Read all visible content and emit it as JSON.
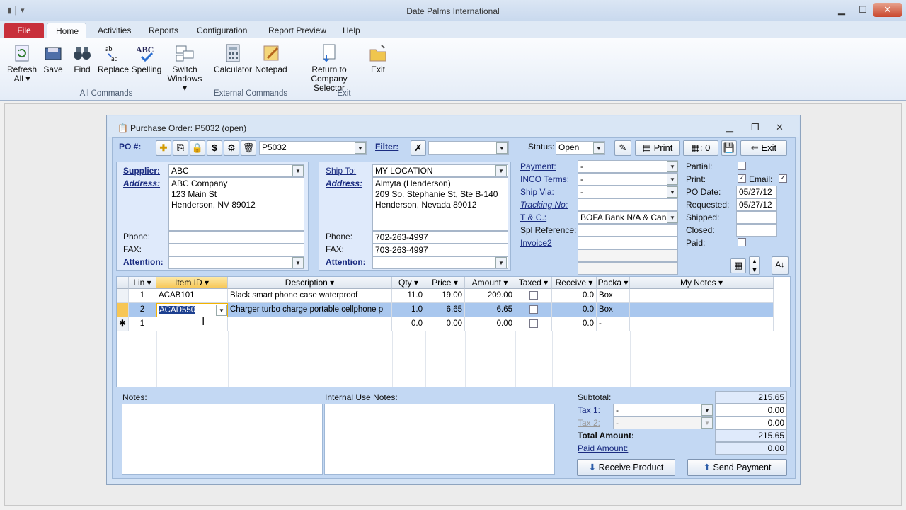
{
  "app": {
    "title": "Date Palms International"
  },
  "ribbon": {
    "tabs": [
      "File",
      "Home",
      "Activities",
      "Reports",
      "Configuration",
      "Report Preview",
      "Help"
    ],
    "buttons": {
      "refresh": "Refresh",
      "refresh2": "All",
      "save": "Save",
      "find": "Find",
      "replace": "Replace",
      "spelling": "Spelling",
      "switch": "Switch",
      "switch2": "Windows",
      "calculator": "Calculator",
      "notepad": "Notepad",
      "return": "Return to",
      "return2": "Company Selector",
      "exit": "Exit"
    },
    "groups": {
      "all": "All Commands",
      "external": "External Commands",
      "exit": "Exit"
    }
  },
  "po": {
    "window_title": "Purchase Order: P5032 (open)",
    "po_label": "PO #:",
    "po_number": "P5032",
    "filter_label": "Filter:",
    "status_label": "Status:",
    "status": "Open",
    "print": "Print",
    "copies": ": 0",
    "exit": "Exit"
  },
  "supplier": {
    "supplier_label": "Supplier:",
    "supplier": "ABC",
    "address_label": "Address:",
    "address": [
      "ABC Company",
      "123 Main St",
      "Henderson, NV 89012"
    ],
    "phone_label": "Phone:",
    "fax_label": "FAX:",
    "attention_label": "Attention:"
  },
  "shipto": {
    "label": "Ship To:",
    "value": "MY LOCATION",
    "address_label": "Address:",
    "address": [
      "Almyta (Henderson)",
      "209 So. Stephanie St, Ste B-140",
      "Henderson, Nevada 89012"
    ],
    "phone_label": "Phone:",
    "phone": "702-263-4997",
    "fax_label": "FAX:",
    "fax": "703-263-4997",
    "attention_label": "Attention:"
  },
  "terms": {
    "payment_label": "Payment:",
    "payment": "-",
    "inco_label": "INCO Terms:",
    "inco": "-",
    "shipvia_label": "Ship Via:",
    "shipvia": "-",
    "tracking_label": "Tracking No:",
    "tc_label": "T & C.:",
    "tc": "BOFA Bank N/A & Cana",
    "splref_label": "Spl Reference:",
    "invoice2_label": "Invoice2"
  },
  "flags": {
    "partial_label": "Partial:",
    "print_label": "Print:",
    "email_label": "Email:",
    "podate_label": "PO Date:",
    "podate": "05/27/12",
    "requested_label": "Requested:",
    "requested": "05/27/12",
    "shipped_label": "Shipped:",
    "closed_label": "Closed:",
    "paid_label": "Paid:"
  },
  "grid": {
    "headers": [
      "Lin",
      "Item ID",
      "Description",
      "Qty",
      "Price",
      "Amount",
      "Taxed",
      "Receive",
      "Packa",
      "My Notes"
    ],
    "rows": [
      {
        "lin": "1",
        "item": "ACAB101",
        "desc": "Black smart phone case waterproof",
        "qty": "11.0",
        "price": "19.00",
        "amount": "209.00",
        "receive": "0.0",
        "pack": "Box"
      },
      {
        "lin": "2",
        "item": "ACAD550",
        "desc": "Charger turbo charge portable cellphone p",
        "qty": "1.0",
        "price": "6.65",
        "amount": "6.65",
        "receive": "0.0",
        "pack": "Box"
      },
      {
        "lin": "1",
        "item": "",
        "desc": "",
        "qty": "0.0",
        "price": "0.00",
        "amount": "0.00",
        "receive": "0.0",
        "pack": "-"
      }
    ]
  },
  "footer": {
    "notes_label": "Notes:",
    "internal_label": "Internal Use Notes:",
    "subtotal_label": "Subtotal:",
    "subtotal": "215.65",
    "tax1_label": "Tax 1:",
    "tax1": "-",
    "tax1_amt": "0.00",
    "tax2_label": "Tax 2:",
    "tax2": "-",
    "tax2_amt": "0.00",
    "total_label": "Total Amount:",
    "total": "215.65",
    "paid_label": "Paid Amount:",
    "paid": "0.00",
    "receive_btn": "Receive Product",
    "send_btn": "Send Payment"
  }
}
